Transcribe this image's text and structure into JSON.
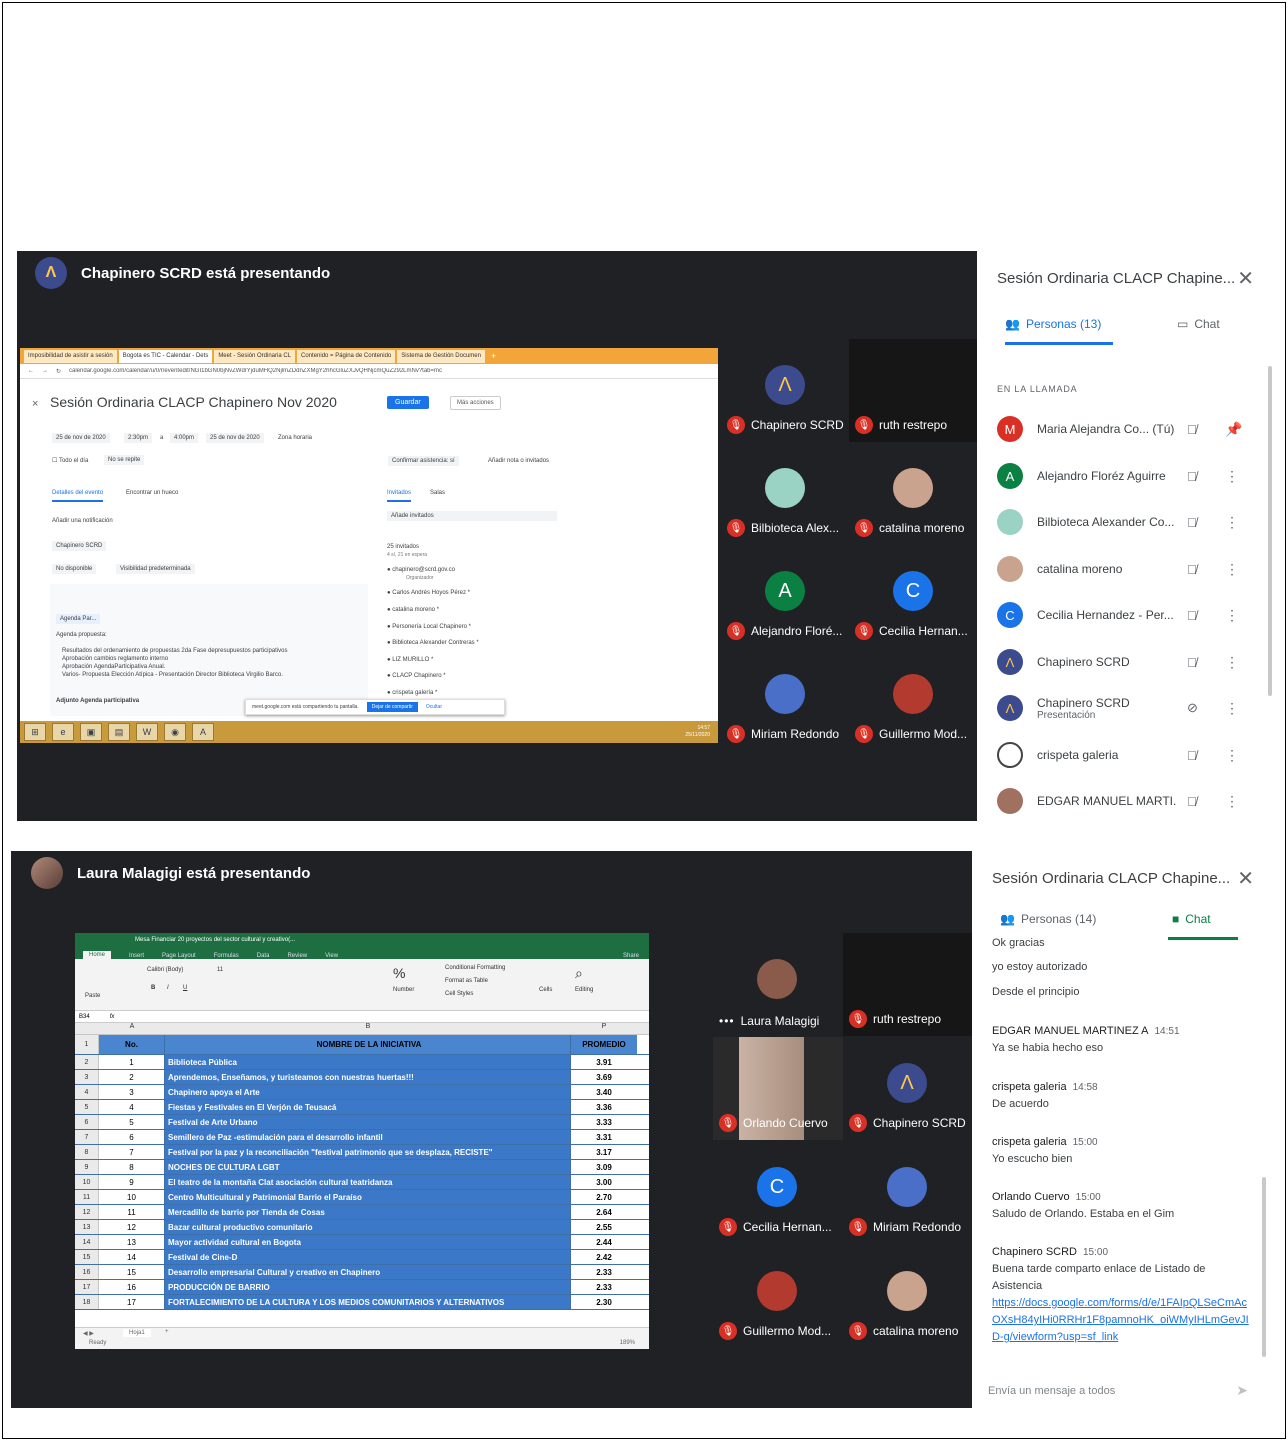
{
  "top_meeting": {
    "presenter_text": "Chapinero SCRD está presentando",
    "tiles": [
      {
        "name": "Chapinero SCRD",
        "avatar": "Λ",
        "color": "#3c4a8e"
      },
      {
        "name": "ruth restrepo",
        "avatar": "",
        "color": "#2a2a2a"
      },
      {
        "name": "Bilbioteca Alex...",
        "avatar": "",
        "color": "#9ad3c4"
      },
      {
        "name": "catalina moreno",
        "avatar": "",
        "color": "#c9a38e"
      },
      {
        "name": "Alejandro Floré...",
        "avatar": "A",
        "color": "#0b8043"
      },
      {
        "name": "Cecilia Hernan...",
        "avatar": "C",
        "color": "#1a73e8"
      },
      {
        "name": "Miriam Redondo",
        "avatar": "",
        "color": "#4a6fc9"
      },
      {
        "name": "Guillermo Mod...",
        "avatar": "",
        "color": "#b23a2f"
      }
    ],
    "calendar": {
      "tabs": [
        "Imposibilidad de asistir a sesión",
        "Bogota es TIC - Calendar - Dets",
        "Meet - Sesión Ordinaria CL",
        "Contenido = Página de Contenido",
        "Sistema de Gestión Documen"
      ],
      "url": "calendar.google.com/calendar/u/0/r/eventedit/NGI1bGN0bjNvZWdrYjduMHQ2NjlmZDdnZXMgY2hhcGluZXJvQHNjcmQuZ292LmNv?tab=mc",
      "event_title": "Sesión Ordinaria CLACP Chapinero Nov 2020",
      "save_label": "Guardar",
      "more_actions_label": "Más acciones",
      "date_start": "25 de nov de 2020",
      "time_start": "2:30pm",
      "time_sep": "a",
      "time_end": "4:00pm",
      "date_end": "25 de nov de 2020",
      "timezone": "Zona horaria",
      "all_day": "Todo el día",
      "repeat": "No se repite",
      "tab_details": "Detalles del evento",
      "tab_find": "Encontrar un hueco",
      "notification": "Añadir una notificación",
      "calendar_owner": "Chapinero SCRD",
      "availability": "No disponible",
      "visibility": "Visibilidad predeterminada",
      "attachment": "Agenda Par...",
      "agenda_heading": "Agenda propuesta:",
      "agenda_items": [
        "Resultados del ordenamiento de propuestas 2da Fase depresupuestos participativos",
        "Aprobación cambios  reglamento interno",
        "Aprobación AgendaParticipativa Anual.",
        "Varios- Propuesta Elección Atípica - Presentación Director Biblioteca Virgilio Barco."
      ],
      "agenda_footer": "Adjunto Agenda participativa",
      "rsvp": "Confirmar asistencia: sí",
      "add_note": "Añadir nota o invitados",
      "tab_guests": "Invitados",
      "tab_rooms": "Salas",
      "add_guests": "Añade invitados",
      "guest_count": "25 invitados",
      "guest_waiting": "4 sí, 21 en espera",
      "guests": [
        "chapinero@scrd.gov.co",
        "Carlos Andrés Hoyos Pérez *",
        "catalina moreno *",
        "Personería Local Chapinero *",
        "Biblioteca Alexander Contreras *",
        "LIZ MURILLO *",
        "CLACP Chapinero *",
        "crispeta galería *"
      ],
      "organizer": "Organizador",
      "share_notice": "meet.google.com está compartiendo tu pantalla.",
      "stop_share": "Dejar de compartir",
      "hide": "Ocultar",
      "clock_time": "14:57",
      "clock_date": "25/11/2020"
    },
    "panel": {
      "title": "Sesión Ordinaria CLACP Chapine...",
      "tab_people": "Personas (13)",
      "tab_chat": "Chat",
      "section": "EN LA LLAMADA",
      "people": [
        {
          "name": "Maria Alejandra Co...  (Tú)",
          "sub": "",
          "avatar": "M",
          "color": "#d93025"
        },
        {
          "name": "Alejandro Floréz Aguirre",
          "sub": "",
          "avatar": "A",
          "color": "#0b8043"
        },
        {
          "name": "Bilbioteca Alexander Co...",
          "sub": "",
          "avatar": "",
          "color": "#9ad3c4"
        },
        {
          "name": "catalina moreno",
          "sub": "",
          "avatar": "",
          "color": "#c9a38e"
        },
        {
          "name": "Cecilia Hernandez - Per...",
          "sub": "",
          "avatar": "C",
          "color": "#1a73e8"
        },
        {
          "name": "Chapinero SCRD",
          "sub": "",
          "avatar": "Λ",
          "color": "#3c4a8e"
        },
        {
          "name": "Chapinero SCRD",
          "sub": "Presentación",
          "avatar": "Λ",
          "color": "#3c4a8e"
        },
        {
          "name": "crispeta galeria",
          "sub": "",
          "avatar": "",
          "color": "#444444"
        },
        {
          "name": "EDGAR MANUEL MARTI...",
          "sub": "",
          "avatar": "",
          "color": "#a07060"
        }
      ]
    }
  },
  "bottom_meeting": {
    "presenter_text": "Laura Malagigi está presentando",
    "tiles": [
      {
        "name": "Laura Malagigi",
        "avatar": "",
        "color": "#8a5a4a",
        "speaking": true
      },
      {
        "name": "ruth restrepo",
        "avatar": "",
        "color": "#2a2a2a",
        "speaking": false
      },
      {
        "name": "Orlando Cuervo",
        "avatar": "",
        "color": "#c9b3a5",
        "speaking": false
      },
      {
        "name": "Chapinero SCRD",
        "avatar": "Λ",
        "color": "#3c4a8e",
        "speaking": false
      },
      {
        "name": "Cecilia Hernan...",
        "avatar": "C",
        "color": "#1a73e8",
        "speaking": false
      },
      {
        "name": "Miriam Redondo",
        "avatar": "",
        "color": "#4a6fc9",
        "speaking": false
      },
      {
        "name": "Guillermo Mod...",
        "avatar": "",
        "color": "#b23a2f",
        "speaking": false
      },
      {
        "name": "catalina moreno",
        "avatar": "",
        "color": "#c9a38e",
        "speaking": false
      }
    ],
    "excel": {
      "file_title": "Mesa  Financiar 20 proyectos del sector cultural y creativo(...",
      "ribbon_tabs": [
        "Home",
        "Insert",
        "Page Layout",
        "Formulas",
        "Data",
        "Review",
        "View"
      ],
      "share_label": "Share",
      "font_name": "Calibri (Body)",
      "font_size": "11",
      "paste": "Paste",
      "number": "Number",
      "conditional": "Conditional Formatting",
      "format_table": "Format as Table",
      "cell_styles": "Cell Styles",
      "cells": "Cells",
      "editing": "Editing",
      "cell_ref": "B34",
      "fx": "fx",
      "col_headers": [
        "A",
        "B",
        "P"
      ],
      "header_row": {
        "num": "1",
        "a": "No.",
        "b": "NOMBRE DE LA INICIATIVA",
        "c": "PROMEDIO"
      },
      "rows": [
        {
          "r": "2",
          "a": "1",
          "b": "Biblioteca Pública",
          "c": "3.91"
        },
        {
          "r": "3",
          "a": "2",
          "b": "Aprendemos, Enseñamos, y turisteamos con nuestras huertas!!!",
          "c": "3.69"
        },
        {
          "r": "4",
          "a": "3",
          "b": "Chapinero apoya el Arte",
          "c": "3.40"
        },
        {
          "r": "5",
          "a": "4",
          "b": "Fiestas y Festivales en El Verjón de Teusacá",
          "c": "3.36"
        },
        {
          "r": "6",
          "a": "5",
          "b": "Festival de Arte Urbano",
          "c": "3.33"
        },
        {
          "r": "7",
          "a": "6",
          "b": "Semillero de Paz -estimulación para el desarrollo infantil",
          "c": "3.31"
        },
        {
          "r": "8",
          "a": "7",
          "b": "Festival por la paz y la reconciliación \"festival patrimonio que se desplaza, RECISTE\"",
          "c": "3.17"
        },
        {
          "r": "9",
          "a": "8",
          "b": "NOCHES DE CULTURA LGBT",
          "c": "3.09"
        },
        {
          "r": "10",
          "a": "9",
          "b": "El teatro de la montaña Clat asociación cultural teatridanza",
          "c": "3.00"
        },
        {
          "r": "11",
          "a": "10",
          "b": "Centro Multicultural y Patrimonial Barrio el Paraíso",
          "c": "2.70"
        },
        {
          "r": "12",
          "a": "11",
          "b": "Mercadillo de barrio por Tienda de Cosas",
          "c": "2.64"
        },
        {
          "r": "13",
          "a": "12",
          "b": "Bazar cultural productivo comunitario",
          "c": "2.55"
        },
        {
          "r": "14",
          "a": "13",
          "b": "Mayor actividad cultural en Bogota",
          "c": "2.44"
        },
        {
          "r": "15",
          "a": "14",
          "b": "Festival de Cine-D",
          "c": "2.42"
        },
        {
          "r": "16",
          "a": "15",
          "b": "Desarrollo empresarial Cultural y creativo en Chapinero",
          "c": "2.33"
        },
        {
          "r": "17",
          "a": "16",
          "b": "PRODUCCIÓN DE BARRIO",
          "c": "2.33"
        },
        {
          "r": "18",
          "a": "17",
          "b": "FORTALECIMIENTO DE LA CULTURA Y LOS MEDIOS COMUNITARIOS Y ALTERNATIVOS",
          "c": "2.30"
        }
      ],
      "sheet_tab": "Hoja1",
      "status": "Ready",
      "zoom": "189%"
    },
    "panel": {
      "title": "Sesión Ordinaria CLACP Chapine...",
      "tab_people": "Personas (14)",
      "tab_chat": "Chat",
      "messages": [
        {
          "who": "",
          "time": "",
          "text": "Ok gracias"
        },
        {
          "who": "",
          "time": "",
          "text": "yo estoy autorizado"
        },
        {
          "who": "",
          "time": "",
          "text": "Desde el principio"
        },
        {
          "who": "EDGAR MANUEL MARTINEZ A",
          "time": "14:51",
          "text": "Ya se habia hecho eso"
        },
        {
          "who": "crispeta galeria",
          "time": "14:58",
          "text": "De acuerdo"
        },
        {
          "who": "crispeta galeria",
          "time": "15:00",
          "text": "Yo escucho bien"
        },
        {
          "who": "Orlando Cuervo",
          "time": "15:00",
          "text": "Saludo de Orlando. Estaba en el Gim"
        },
        {
          "who": "Chapinero SCRD",
          "time": "15:00",
          "text": "Buena tarde comparto enlace de Listado de Asistencia"
        }
      ],
      "link": "https://docs.google.com/forms/d/e/1FAIpQLSeCmAcOXsH84yIHi0RRHr1F8pamnoHK_oiWMyIHLmGevJID-g/viewform?usp=sf_link",
      "input_placeholder": "Envía un mensaje a todos"
    }
  }
}
